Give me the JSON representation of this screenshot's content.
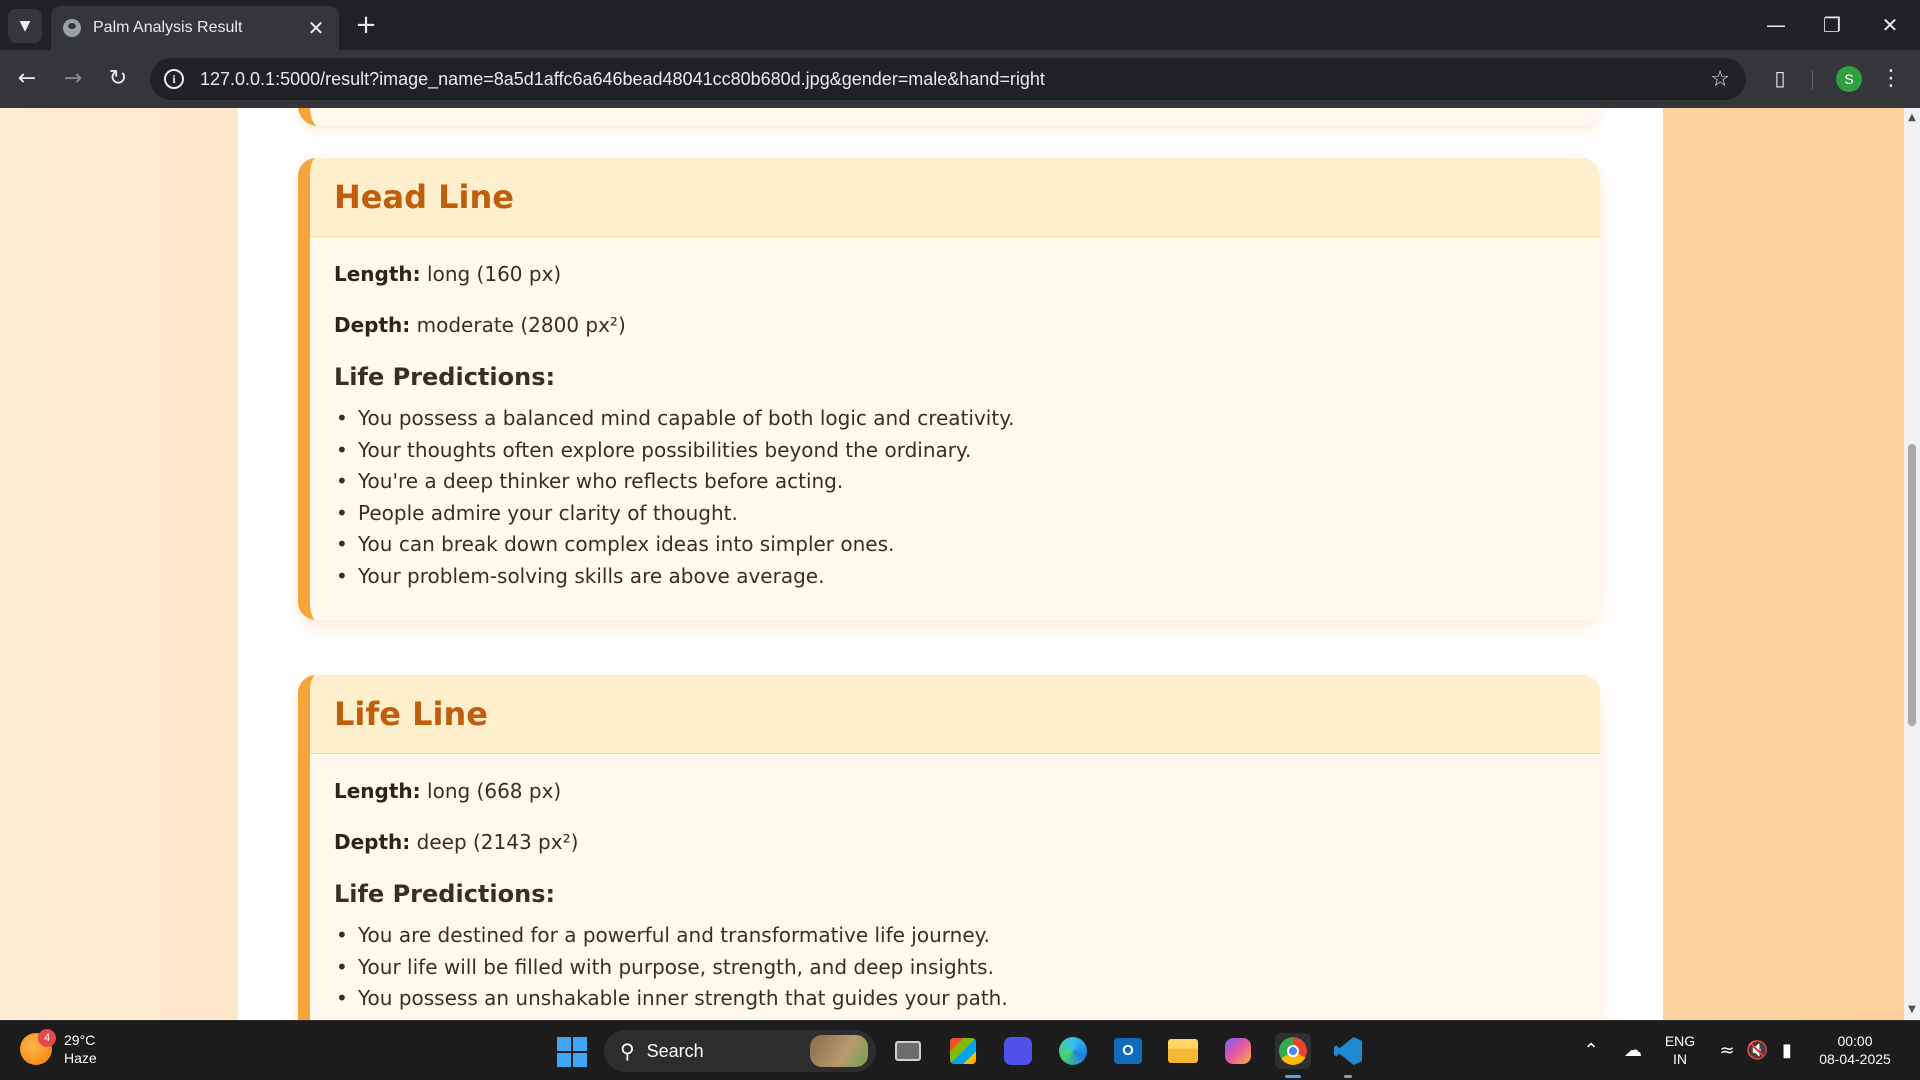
{
  "browser": {
    "tab_title": "Palm Analysis Result",
    "url": "127.0.0.1:5000/result?image_name=8a5d1affc6a646bead48041cc80b680d.jpg&gender=male&hand=right",
    "profile_initial": "S"
  },
  "page": {
    "cards": [
      {
        "title": "Head Line",
        "length_label": "Length:",
        "length_value": "long (160 px)",
        "depth_label": "Depth:",
        "depth_value": "moderate (2800 px²)",
        "predictions_title": "Life Predictions:",
        "predictions": [
          "You possess a balanced mind capable of both logic and creativity.",
          "Your thoughts often explore possibilities beyond the ordinary.",
          "You're a deep thinker who reflects before acting.",
          "People admire your clarity of thought.",
          "You can break down complex ideas into simpler ones.",
          "Your problem-solving skills are above average."
        ]
      },
      {
        "title": "Life Line",
        "length_label": "Length:",
        "length_value": "long (668 px)",
        "depth_label": "Depth:",
        "depth_value": "deep (2143 px²)",
        "predictions_title": "Life Predictions:",
        "predictions": [
          "You are destined for a powerful and transformative life journey.",
          "Your life will be filled with purpose, strength, and deep insights.",
          "You possess an unshakable inner strength that guides your path."
        ]
      }
    ]
  },
  "taskbar": {
    "weather_temp": "29°C",
    "weather_desc": "Haze",
    "weather_badge": "4",
    "search_label": "Search",
    "lang_top": "ENG",
    "lang_bottom": "IN",
    "time": "00:00",
    "date": "08-04-2025"
  },
  "colors": {
    "accent": "#f5a53a",
    "card_title": "#c05e0c",
    "card_header_bg": "#feefcd",
    "card_bg": "#fff8ec"
  }
}
